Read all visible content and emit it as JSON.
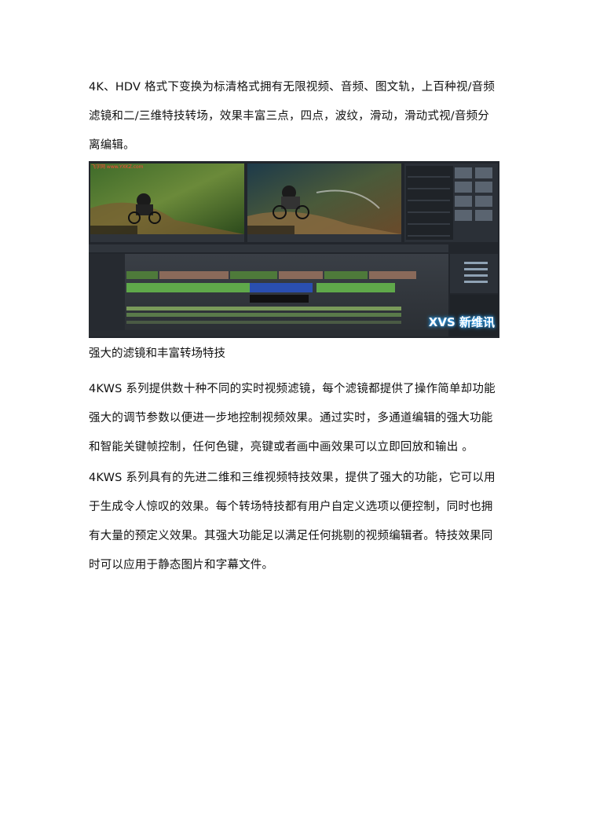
{
  "paragraph1": {
    "line1": "4K、HDV 格式下变换为标清格式拥有无限视频、音频、图文轨，上百种视/音频",
    "line2": "滤镜和二/三维特技转场，效果丰富三点，四点，波纹，滑动，滑动式视/音频分",
    "line3": "离编辑。"
  },
  "figure": {
    "watermark_left": "飞字网 www.YXKZ.com",
    "watermark_right": "XVS 新维讯"
  },
  "heading": "强大的滤镜和丰富转场特技",
  "paragraph2": {
    "line1": "4KWS 系列提供数十种不同的实时视频滤镜，每个滤镜都提供了操作简单却功能",
    "line2": "强大的调节参数以便进一步地控制视频效果。通过实时，多通道编辑的强大功能",
    "line3": "和智能关键帧控制，任何色键，亮键或者画中画效果可以立即回放和输出 。"
  },
  "paragraph3": {
    "line1": "4KWS 系列具有的先进二维和三维视频特技效果，提供了强大的功能，它可以用",
    "line2": "于生成令人惊叹的效果。每个转场特技都有用户自定义选项以便控制，同时也拥",
    "line3": "有大量的预定义效果。其强大功能足以满足任何挑剔的视频编辑者。特技效果同",
    "line4": "时可以应用于静态图片和字幕文件。"
  }
}
